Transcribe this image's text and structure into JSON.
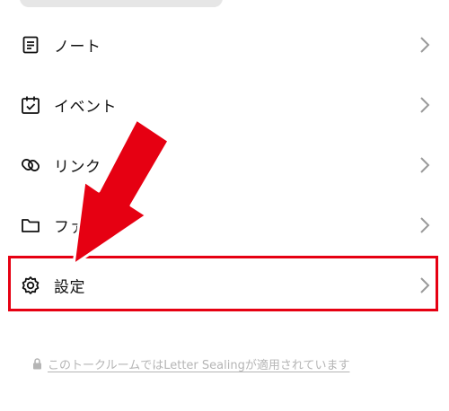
{
  "menu": {
    "items": [
      {
        "label": "ノート",
        "icon": "note-icon"
      },
      {
        "label": "イベント",
        "icon": "calendar-check-icon"
      },
      {
        "label": "リンク",
        "icon": "link-icon"
      },
      {
        "label": "ファイル",
        "icon": "folder-icon"
      },
      {
        "label": "設定",
        "icon": "gear-icon"
      }
    ],
    "chevron_icon": "chevron-right-icon"
  },
  "footer": {
    "lock_icon": "lock-icon",
    "text": "このトークルームではLetter Sealingが適用されています"
  },
  "colors": {
    "highlight": "#e60012",
    "text": "#111111",
    "chevron": "#9a9a9a",
    "footer_text": "#b5b5b5",
    "top_pill": "#e6e6e6"
  }
}
